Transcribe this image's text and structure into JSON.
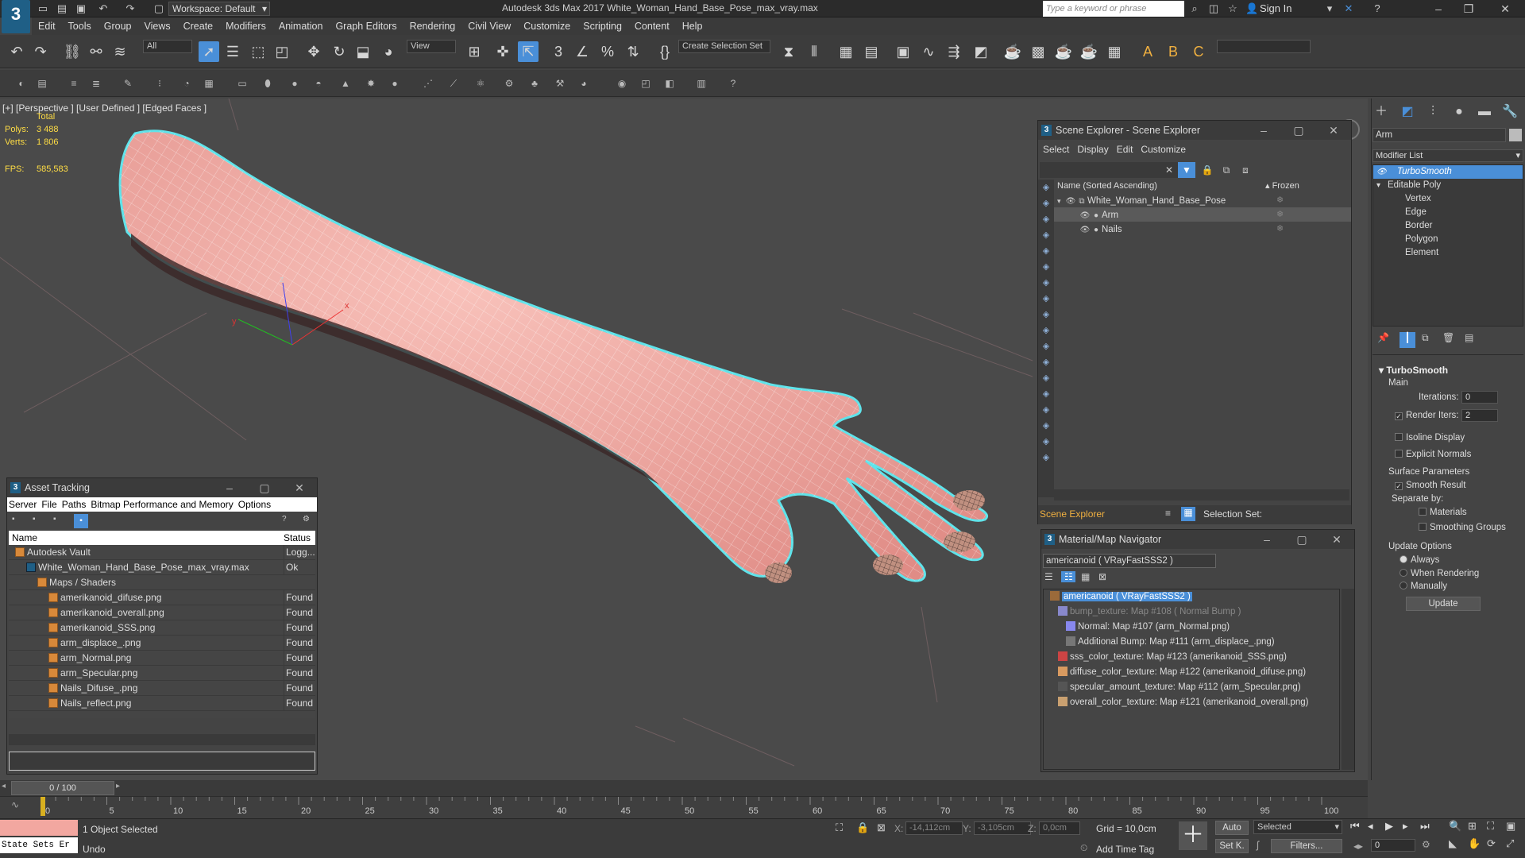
{
  "app": {
    "title": "Autodesk 3ds Max 2017     White_Woman_Hand_Base_Pose_max_vray.max",
    "workspace": "Workspace: Default",
    "search_placeholder": "Type a keyword or phrase",
    "sign_in": "Sign In"
  },
  "menu": [
    "Edit",
    "Tools",
    "Group",
    "Views",
    "Create",
    "Modifiers",
    "Animation",
    "Graph Editors",
    "Rendering",
    "Civil View",
    "Customize",
    "Scripting",
    "Content",
    "Help"
  ],
  "toolbar": {
    "filter_value": "All",
    "ref_coord": "View",
    "selection_set": "Create Selection Set"
  },
  "viewport": {
    "label": "[+] [Perspective ]  [User Defined ]  [Edged Faces ]",
    "stats_total": "Total",
    "polys_label": "Polys:",
    "polys_value": "3 488",
    "verts_label": "Verts:",
    "verts_value": "1 806",
    "fps_label": "FPS:",
    "fps_value": "585,583",
    "axis_x": "x",
    "axis_y": "y",
    "axis_z": "z"
  },
  "scene_explorer": {
    "title": "Scene Explorer - Scene Explorer",
    "menu": [
      "Select",
      "Display",
      "Edit",
      "Customize"
    ],
    "col_name": "Name (Sorted Ascending)",
    "col_frozen": "▴ Frozen",
    "items": [
      {
        "name": "White_Woman_Hand_Base_Pose",
        "level": 0
      },
      {
        "name": "Arm",
        "level": 1
      },
      {
        "name": "Nails",
        "level": 1
      }
    ],
    "footer_label": "Scene Explorer",
    "selection_set": "Selection Set:"
  },
  "asset_tracking": {
    "title": "Asset Tracking",
    "menu": [
      "Server",
      "File",
      "Paths",
      "Bitmap Performance and Memory",
      "Options"
    ],
    "col_name": "Name",
    "col_status": "Status",
    "rows": [
      {
        "name": "Autodesk Vault",
        "status": "Logg...",
        "indent": 0
      },
      {
        "name": "White_Woman_Hand_Base_Pose_max_vray.max",
        "status": "Ok",
        "indent": 1
      },
      {
        "name": "Maps / Shaders",
        "status": "",
        "indent": 2
      },
      {
        "name": "amerikanoid_difuse.png",
        "status": "Found",
        "indent": 3
      },
      {
        "name": "amerikanoid_overall.png",
        "status": "Found",
        "indent": 3
      },
      {
        "name": "amerikanoid_SSS.png",
        "status": "Found",
        "indent": 3
      },
      {
        "name": "arm_displace_.png",
        "status": "Found",
        "indent": 3
      },
      {
        "name": "arm_Normal.png",
        "status": "Found",
        "indent": 3
      },
      {
        "name": "arm_Specular.png",
        "status": "Found",
        "indent": 3
      },
      {
        "name": "Nails_Difuse_.png",
        "status": "Found",
        "indent": 3
      },
      {
        "name": "Nails_reflect.png",
        "status": "Found",
        "indent": 3
      }
    ]
  },
  "material_navigator": {
    "title": "Material/Map Navigator",
    "current": "americanoid  ( VRayFastSSS2 )",
    "items": [
      {
        "label": "americanoid  ( VRayFastSSS2 )",
        "indent": 0,
        "color": "#9b6a3a"
      },
      {
        "label": "bump_texture: Map #108  ( Normal Bump )",
        "indent": 1,
        "color": "#8888cc"
      },
      {
        "label": "Normal: Map #107 (arm_Normal.png)",
        "indent": 2,
        "color": "#8888ee"
      },
      {
        "label": "Additional Bump: Map #111 (arm_displace_.png)",
        "indent": 2,
        "color": "#777777"
      },
      {
        "label": "sss_color_texture: Map #123 (amerikanoid_SSS.png)",
        "indent": 1,
        "color": "#cc4444"
      },
      {
        "label": "diffuse_color_texture: Map #122 (amerikanoid_difuse.png)",
        "indent": 1,
        "color": "#d89a60"
      },
      {
        "label": "specular_amount_texture: Map #112 (arm_Specular.png)",
        "indent": 1,
        "color": "#555555"
      },
      {
        "label": "overall_color_texture: Map #121 (amerikanoid_overall.png)",
        "indent": 1,
        "color": "#c9a070"
      }
    ]
  },
  "command_panel": {
    "object_name": "Arm",
    "modifier_list": "Modifier List",
    "stack": [
      {
        "label": "TurboSmooth",
        "indent": 0,
        "selected": true
      },
      {
        "label": "Editable Poly",
        "indent": 0,
        "selected": false
      },
      {
        "label": "Vertex",
        "indent": 1,
        "selected": false
      },
      {
        "label": "Edge",
        "indent": 1,
        "selected": false
      },
      {
        "label": "Border",
        "indent": 1,
        "selected": false
      },
      {
        "label": "Polygon",
        "indent": 1,
        "selected": false
      },
      {
        "label": "Element",
        "indent": 1,
        "selected": false
      }
    ],
    "rollout_title": "TurboSmooth",
    "main_label": "Main",
    "iterations_label": "Iterations:",
    "iterations_value": "0",
    "render_iters_label": "Render Iters:",
    "render_iters_value": "2",
    "isoline_display": "Isoline Display",
    "explicit_normals": "Explicit Normals",
    "surface_params": "Surface Parameters",
    "smooth_result": "Smooth Result",
    "separate_by": "Separate by:",
    "materials": "Materials",
    "smoothing_groups": "Smoothing Groups",
    "update_options": "Update Options",
    "always": "Always",
    "when_rendering": "When Rendering",
    "manually": "Manually",
    "update_btn": "Update"
  },
  "timeline": {
    "frame": "0 / 100",
    "ticks": [
      "0",
      "5",
      "10",
      "15",
      "20",
      "25",
      "30",
      "35",
      "40",
      "45",
      "50",
      "55",
      "60",
      "65",
      "70",
      "75",
      "80",
      "85",
      "90",
      "95",
      "100"
    ]
  },
  "status": {
    "script_listener": "State Sets Er",
    "selected": "1 Object Selected",
    "undo": "Undo",
    "x_label": "X:",
    "x_value": "-14,112cm",
    "y_label": "Y:",
    "y_value": "-3,105cm",
    "z_label": "Z:",
    "z_value": "0,0cm",
    "grid": "Grid = 10,0cm",
    "add_time_tag": "Add Time Tag",
    "auto": "Auto",
    "set_key": "Set K.",
    "selected_dropdown": "Selected",
    "filters": "Filters...",
    "frame_value": "0"
  },
  "colors": {
    "skin": "#f2a7a0",
    "selection_outline": "#5fe3ea",
    "accent_blue": "#4a8fd8",
    "stats_yellow": "#ffdd44"
  }
}
